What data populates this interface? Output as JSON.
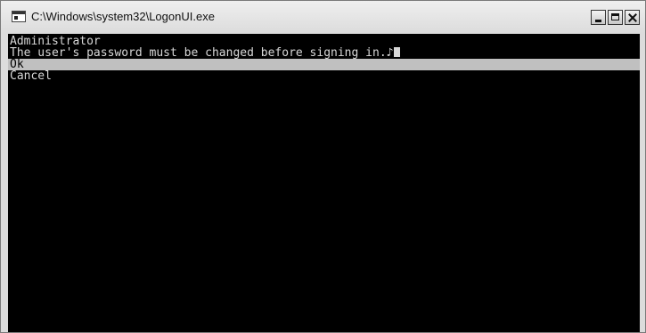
{
  "window": {
    "title": "C:\\Windows\\system32\\LogonUI.exe"
  },
  "console": {
    "lines": [
      "Administrator",
      "The user's password must be changed before signing in.♪"
    ],
    "options": {
      "ok": "Ok",
      "cancel": "Cancel"
    },
    "selected_option": "Ok"
  },
  "colors": {
    "console_bg": "#000000",
    "console_text": "#d8d8d8",
    "highlight_bg": "#c0c0c0",
    "titlebar_bg": "#dcdcdc"
  },
  "icons": {
    "app": "console-app-icon",
    "minimize": "minimize-icon",
    "maximize": "maximize-icon",
    "close": "close-icon"
  }
}
